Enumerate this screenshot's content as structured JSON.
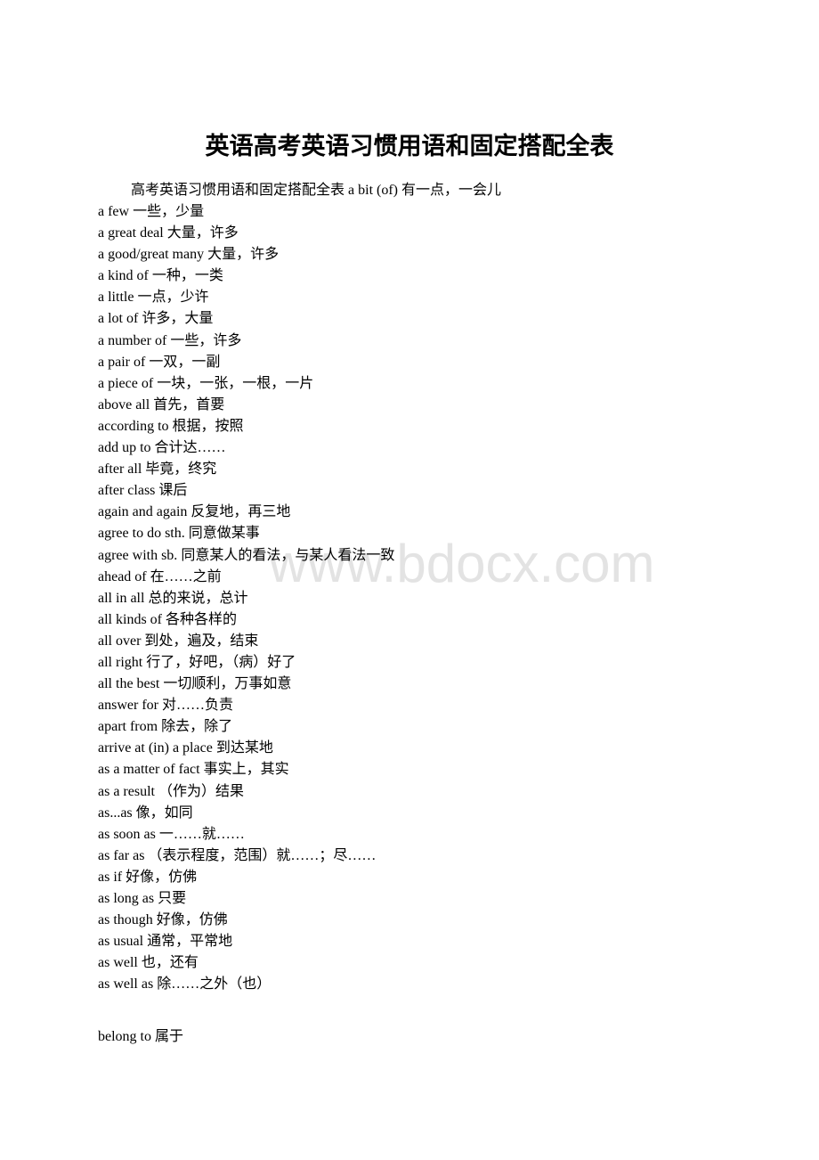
{
  "document": {
    "title": "英语高考英语习惯用语和固定搭配全表",
    "intro": {
      "prefix": "高考英语习惯用语和固定搭配全表",
      "en": "a bit (of)",
      "zh": "有一点，一会儿"
    },
    "entries": [
      {
        "en": "a few",
        "zh": "一些，少量"
      },
      {
        "en": "a great deal",
        "zh": "大量，许多"
      },
      {
        "en": "a good/great many",
        "zh": "大量，许多"
      },
      {
        "en": "a kind of",
        "zh": "一种，一类"
      },
      {
        "en": "a little",
        "zh": "一点，少许"
      },
      {
        "en": "a lot of",
        "zh": "许多，大量"
      },
      {
        "en": "a number of",
        "zh": "一些，许多"
      },
      {
        "en": "a pair of",
        "zh": "一双，一副"
      },
      {
        "en": "a piece of",
        "zh": "一块，一张，一根，一片"
      },
      {
        "en": "above all",
        "zh": "首先，首要"
      },
      {
        "en": "according to",
        "zh": "根据，按照"
      },
      {
        "en": "add up to",
        "zh": "合计达……"
      },
      {
        "en": "after all",
        "zh": "毕竟，终究"
      },
      {
        "en": "after class",
        "zh": "课后"
      },
      {
        "en": "again and again",
        "zh": "反复地，再三地"
      },
      {
        "en": "agree to do sth.",
        "zh": "同意做某事"
      },
      {
        "en": "agree with sb.",
        "zh": "同意某人的看法，与某人看法一致"
      },
      {
        "en": "ahead of",
        "zh": "在……之前"
      },
      {
        "en": "all in all",
        "zh": "总的来说，总计"
      },
      {
        "en": "all kinds of",
        "zh": "各种各样的"
      },
      {
        "en": "all over",
        "zh": "到处，遍及，结束"
      },
      {
        "en": "all right",
        "zh": "行了，好吧，（病）好了"
      },
      {
        "en": "all the best",
        "zh": "一切顺利，万事如意"
      },
      {
        "en": "answer for",
        "zh": "对……负责"
      },
      {
        "en": "apart from",
        "zh": "除去，除了"
      },
      {
        "en": "arrive at (in) a place",
        "zh": "到达某地"
      },
      {
        "en": "as a matter of fact",
        "zh": "事实上，其实"
      },
      {
        "en": "as a result",
        "zh": "（作为）结果"
      },
      {
        "en": "as...as",
        "zh": "像，如同"
      },
      {
        "en": "as soon as",
        "zh": "一……就……"
      },
      {
        "en": "as far as",
        "zh": "（表示程度，范围）就……；尽……"
      },
      {
        "en": "as if",
        "zh": "好像，仿佛"
      },
      {
        "en": "as long as",
        "zh": "只要"
      },
      {
        "en": "as though",
        "zh": "好像，仿佛"
      },
      {
        "en": "as usual",
        "zh": "通常，平常地"
      },
      {
        "en": "as well",
        "zh": "也，还有"
      },
      {
        "en": "as well as",
        "zh": "除……之外（也）"
      }
    ],
    "after_gap_entry": {
      "en": "belong to",
      "zh": "属于"
    }
  },
  "watermark": {
    "text": "www.bdocx.com",
    "color": "#e3e3e3"
  }
}
